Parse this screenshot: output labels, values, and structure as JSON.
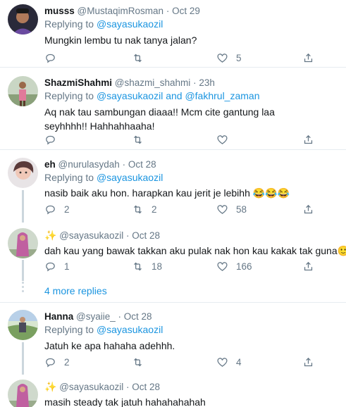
{
  "tweets": [
    {
      "name": "musss",
      "handle": "@MustaqimRosman",
      "separator": "·",
      "time": "Oct 29",
      "replying_prefix": "Replying to",
      "replying_to": "@sayasukaozil",
      "replying_to_2": "",
      "text": "Mungkin lembu tu nak tanya jalan?",
      "reply_count": "",
      "retweet_count": "",
      "like_count": "5"
    },
    {
      "name": "ShazmiShahmi",
      "handle": "@shazmi_shahmi",
      "separator": "·",
      "time": "23h",
      "replying_prefix": "Replying to",
      "replying_to": "@sayasukaozil",
      "replying_and": "and",
      "replying_to_2": "@fakhrul_zaman",
      "text": "Aq nak tau sambungan diaaa!! Mcm cite gantung laa seyhhhh!! Hahhahhaaha!",
      "reply_count": "",
      "retweet_count": "",
      "like_count": ""
    },
    {
      "name": "eh",
      "handle": "@nurulasydah",
      "separator": "·",
      "time": "Oct 28",
      "replying_prefix": "Replying to",
      "replying_to": "@sayasukaozil",
      "text": "nasib baik aku hon. harapkan kau jerit je lebihh ",
      "emoji": "😂😂😂",
      "reply_count": "2",
      "retweet_count": "2",
      "like_count": "58"
    },
    {
      "name": "✨",
      "handle": "@sayasukaozil",
      "separator": "·",
      "time": "Oct 28",
      "text": "dah kau yang bawak takkan aku pulak nak hon kau kakak tak guna",
      "emoji": "🙂",
      "reply_count": "1",
      "retweet_count": "18",
      "like_count": "166"
    },
    {
      "name": "Hanna",
      "handle": "@syaiie_",
      "separator": "·",
      "time": "Oct 28",
      "replying_prefix": "Replying to",
      "replying_to": "@sayasukaozil",
      "text": "Jatuh ke apa hahaha adehhh.",
      "reply_count": "2",
      "retweet_count": "",
      "like_count": "4"
    },
    {
      "name": "✨",
      "handle": "@sayasukaozil",
      "separator": "·",
      "time": "Oct 28",
      "text": "masih steady tak jatuh hahahahahah"
    }
  ],
  "more_replies": "4 more replies",
  "icons": {
    "reply": "reply-icon",
    "retweet": "retweet-icon",
    "like": "heart-icon",
    "share": "share-icon"
  },
  "colors": {
    "link": "#1b95e0",
    "secondary_text": "#657786",
    "divider": "#e6ecf0",
    "thread_line": "#ccd6dd"
  }
}
